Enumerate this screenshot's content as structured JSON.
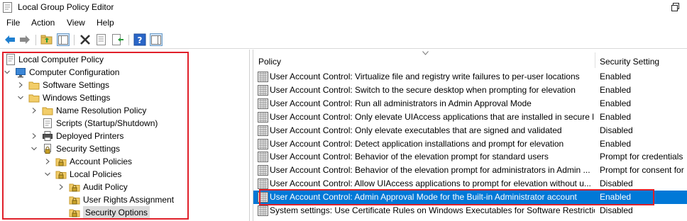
{
  "window": {
    "title": "Local Group Policy Editor"
  },
  "menu": {
    "items": [
      "File",
      "Action",
      "View",
      "Help"
    ]
  },
  "toolbar": {
    "buttons": [
      "back-arrow-icon",
      "forward-arrow-icon",
      "up-folder-icon",
      "show-hide-tree-icon",
      "delete-icon",
      "properties-icon",
      "export-list-icon",
      "help-icon",
      "show-hide-action-pane-icon"
    ]
  },
  "tree": {
    "items": [
      {
        "label": "Local Computer Policy",
        "icon": "policy-doc-icon",
        "expander": "none"
      },
      {
        "label": "Computer Configuration",
        "icon": "computer-icon",
        "expander": "expanded"
      },
      {
        "label": "Software Settings",
        "icon": "folder-icon",
        "expander": "collapsed"
      },
      {
        "label": "Windows Settings",
        "icon": "folder-icon",
        "expander": "expanded"
      },
      {
        "label": "Name Resolution Policy",
        "icon": "folder-icon",
        "expander": "collapsed"
      },
      {
        "label": "Scripts (Startup/Shutdown)",
        "icon": "script-icon",
        "expander": "none"
      },
      {
        "label": "Deployed Printers",
        "icon": "printer-icon",
        "expander": "collapsed"
      },
      {
        "label": "Security Settings",
        "icon": "security-icon",
        "expander": "expanded"
      },
      {
        "label": "Account Policies",
        "icon": "locked-folder-icon",
        "expander": "collapsed"
      },
      {
        "label": "Local Policies",
        "icon": "locked-folder-icon",
        "expander": "expanded"
      },
      {
        "label": "Audit Policy",
        "icon": "locked-folder-icon",
        "expander": "collapsed"
      },
      {
        "label": "User Rights Assignment",
        "icon": "locked-folder-icon",
        "expander": "none"
      },
      {
        "label": "Security Options",
        "icon": "locked-folder-icon",
        "expander": "none",
        "selected": true
      }
    ]
  },
  "list": {
    "columns": {
      "policy": "Policy",
      "setting": "Security Setting"
    },
    "rows": [
      {
        "policy": "User Account Control: Virtualize file and registry write failures to per-user locations",
        "setting": "Enabled"
      },
      {
        "policy": "User Account Control: Switch to the secure desktop when prompting for elevation",
        "setting": "Enabled"
      },
      {
        "policy": "User Account Control: Run all administrators in Admin Approval Mode",
        "setting": "Enabled"
      },
      {
        "policy": "User Account Control: Only elevate UIAccess applications that are installed in secure l...",
        "setting": "Enabled"
      },
      {
        "policy": "User Account Control: Only elevate executables that are signed and validated",
        "setting": "Disabled"
      },
      {
        "policy": "User Account Control: Detect application installations and prompt for elevation",
        "setting": "Enabled"
      },
      {
        "policy": "User Account Control: Behavior of the elevation prompt for standard users",
        "setting": "Prompt for credentials"
      },
      {
        "policy": "User Account Control: Behavior of the elevation prompt for administrators in Admin ...",
        "setting": "Prompt for consent for"
      },
      {
        "policy": "User Account Control: Allow UIAccess applications to prompt for elevation without u...",
        "setting": "Disabled"
      },
      {
        "policy": "User Account Control: Admin Approval Mode for the Built-in Administrator account",
        "setting": "Enabled",
        "selected": true
      },
      {
        "policy": "System settings: Use Certificate Rules on Windows Executables for Software Restrictio...",
        "setting": "Disabled"
      }
    ]
  },
  "colors": {
    "selection": "#0078d7",
    "highlight_box": "#e0202a",
    "tree_selection": "#dcdcdc"
  }
}
